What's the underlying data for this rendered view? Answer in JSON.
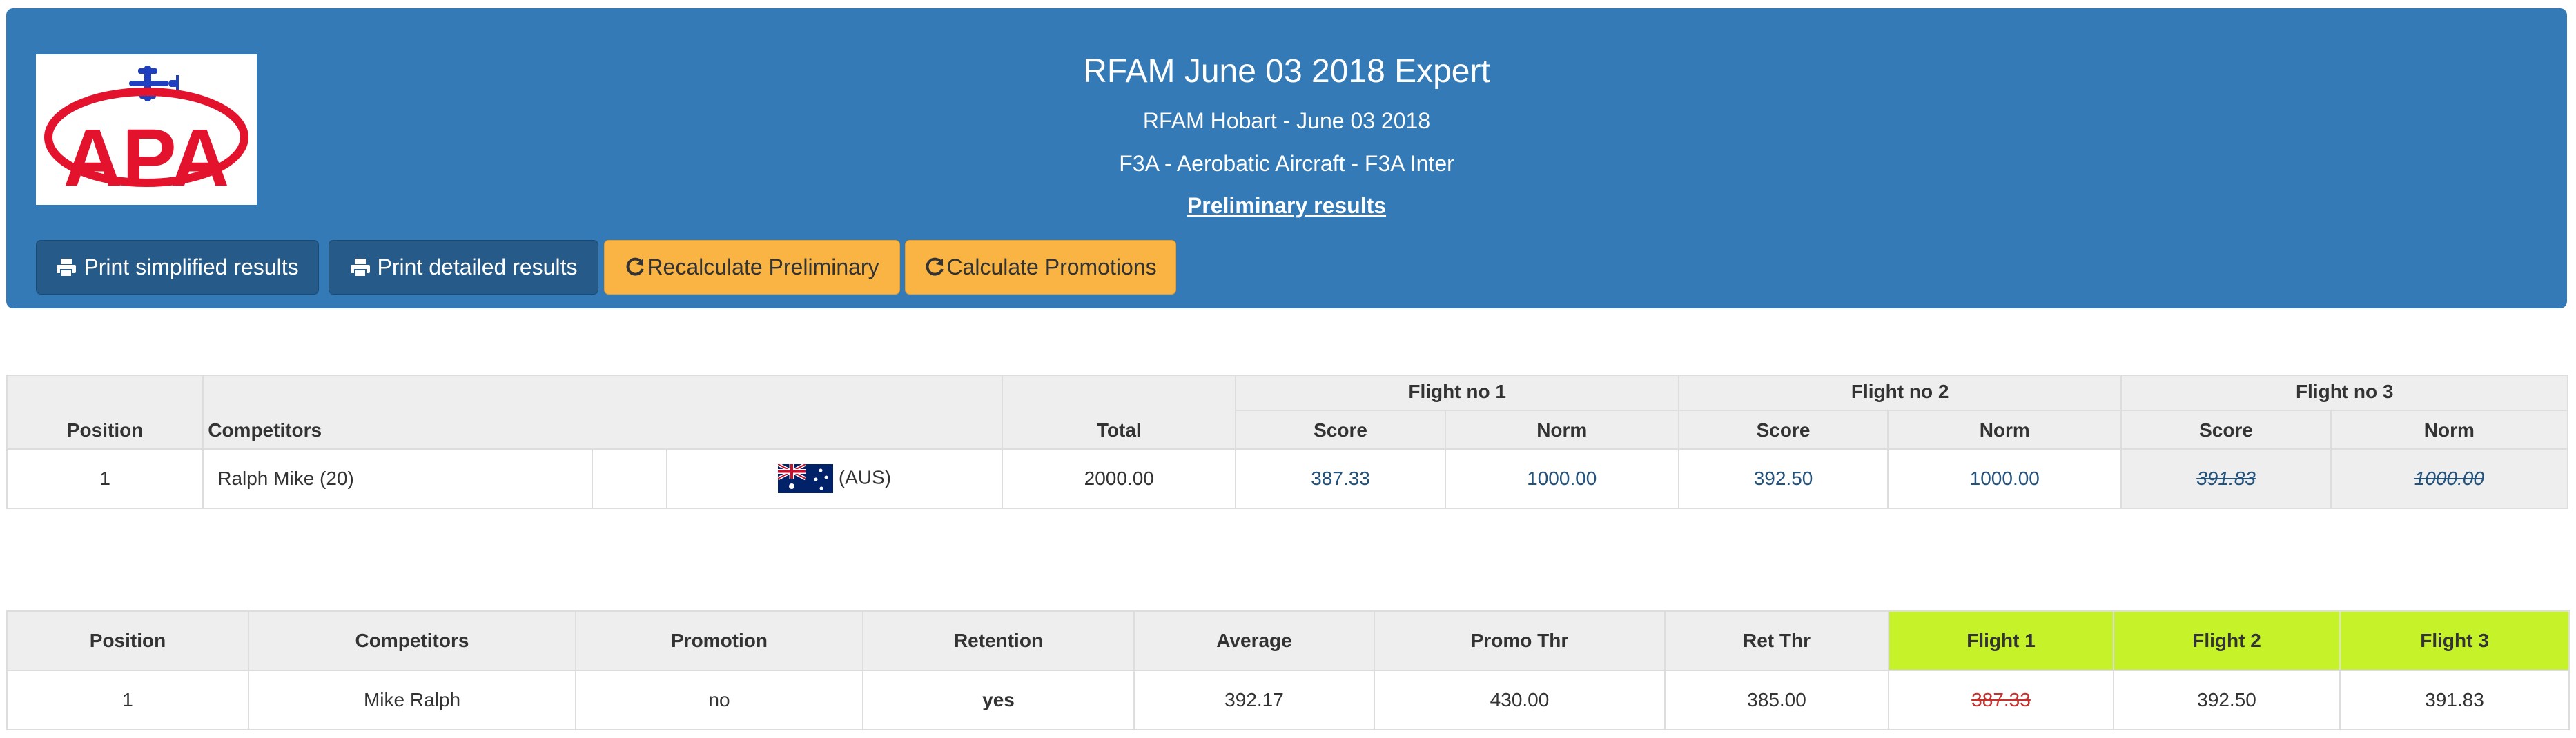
{
  "header": {
    "title": "RFAM June 03 2018 Expert",
    "subtitle": "RFAM Hobart - June 03 2018",
    "category": "F3A - Aerobatic Aircraft - F3A Inter",
    "status": "Preliminary results",
    "logo_text": "APA",
    "buttons": {
      "print_simplified": "Print simplified results",
      "print_detailed": "Print detailed results",
      "recalc_preliminary": "Recalculate Preliminary",
      "calc_promotions": "Calculate Promotions"
    },
    "colors": {
      "panel": "#337ab7",
      "dark_button": "#265a88",
      "warning_button": "#f9b444"
    }
  },
  "results": {
    "headers": {
      "position": "Position",
      "competitors": "Competitors",
      "total": "Total",
      "flights": [
        "Flight no 1",
        "Flight no 2",
        "Flight no 3"
      ],
      "score": "Score",
      "norm": "Norm"
    },
    "rows": [
      {
        "position": "1",
        "name": "Ralph Mike (20)",
        "country": "(AUS)",
        "total": "2000.00",
        "f1_score": "387.33",
        "f1_norm": "1000.00",
        "f2_score": "392.50",
        "f2_norm": "1000.00",
        "f3_score": "391.83",
        "f3_norm": "1000.00"
      }
    ]
  },
  "promotion": {
    "headers": [
      "Position",
      "Competitors",
      "Promotion",
      "Retention",
      "Average",
      "Promo Thr",
      "Ret Thr",
      "Flight 1",
      "Flight 2",
      "Flight 3"
    ],
    "rows": [
      {
        "position": "1",
        "competitor": "Mike Ralph",
        "promotion": "no",
        "retention": "yes",
        "average": "392.17",
        "promo_thr": "430.00",
        "ret_thr": "385.00",
        "flight1": "387.33",
        "flight2": "392.50",
        "flight3": "391.83"
      }
    ],
    "highlight_color": "#c5f229"
  }
}
